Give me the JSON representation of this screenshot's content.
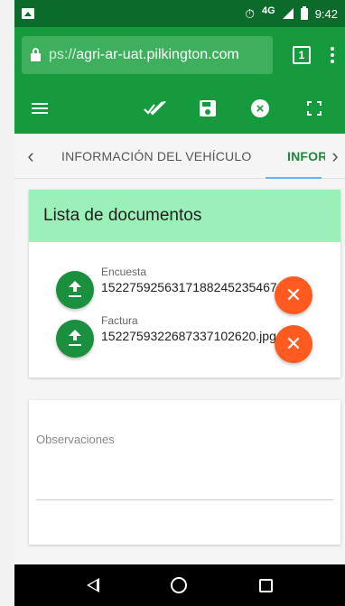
{
  "status_bar": {
    "network": "4G",
    "time": "9:42",
    "icons": [
      "image-icon",
      "alarm-icon",
      "signal-icon",
      "battery-icon"
    ]
  },
  "browser": {
    "url_scheme": "ps://",
    "url_host": "agri-ar-uat.pilkington.com",
    "tab_count": "1",
    "icons": [
      "lock-icon",
      "tab-switcher-icon",
      "overflow-menu-icon"
    ]
  },
  "toolbar": {
    "icons": [
      "menu-icon",
      "double-check-icon",
      "save-icon",
      "cancel-circle-icon",
      "fullscreen-icon"
    ]
  },
  "tabs": {
    "prev_arrow": "‹",
    "next_arrow": "›",
    "items": [
      {
        "label": "INFORMACIÓN DEL VEHÍCULO"
      },
      {
        "label": "INFOR"
      }
    ],
    "active_index": 1
  },
  "documents": {
    "title": "Lista de documentos",
    "items": [
      {
        "label": "Encuesta",
        "filename": "1522759256317188245235467"
      },
      {
        "label": "Factura",
        "filename": "1522759322687337102620.jpg"
      }
    ],
    "remove_symbol": "✕"
  },
  "observations": {
    "label": "Observaciones",
    "value": ""
  },
  "colors": {
    "status_bar": "#0b6b2a",
    "app_bar": "#159a3d",
    "card_header": "#9bf0b7",
    "upload_button": "#1a8f3d",
    "remove_button": "#ff5a1f",
    "active_tab": "#1b8a3a",
    "tab_indicator": "#64b5f6"
  }
}
